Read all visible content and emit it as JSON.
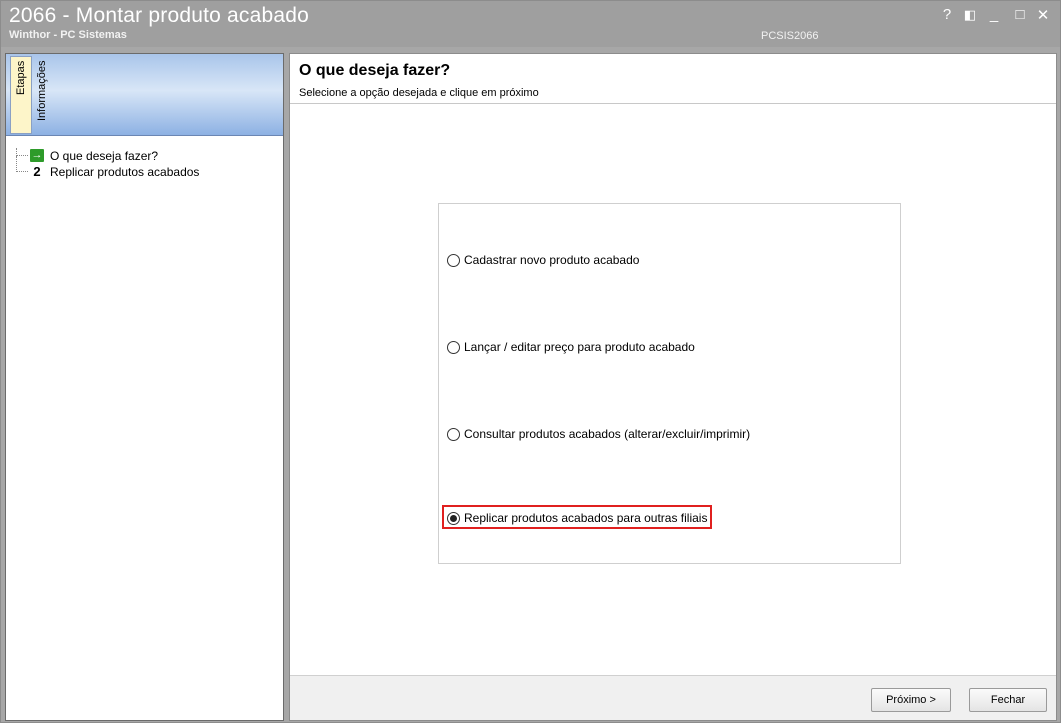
{
  "window": {
    "title": "2066 - Montar produto acabado",
    "subtitle": "Winthor - PC Sistemas",
    "app_code": "PCSIS2066",
    "controls": {
      "help": "?",
      "restore": "◧",
      "minimize": "_",
      "maximize": "□",
      "close": "✕"
    }
  },
  "sidebar": {
    "tabs": [
      "Etapas",
      "Informações"
    ],
    "steps": [
      {
        "icon": "→",
        "label": "O que deseja fazer?"
      },
      {
        "icon": "2",
        "label": "Replicar produtos acabados"
      }
    ]
  },
  "main": {
    "title": "O que deseja fazer?",
    "subtitle": "Selecione a opção desejada e clique em próximo",
    "options": [
      {
        "label": "Cadastrar novo produto acabado",
        "checked": false
      },
      {
        "label": "Lançar / editar preço para produto acabado",
        "checked": false
      },
      {
        "label": "Consultar produtos acabados (alterar/excluir/imprimir)",
        "checked": false
      },
      {
        "label": "Replicar produtos acabados para outras filiais",
        "checked": true
      }
    ]
  },
  "footer": {
    "next_label": "Próximo >",
    "close_label": "Fechar"
  },
  "colors": {
    "highlight": "#e0201f",
    "step_arrow": "#2e9b2a",
    "tab_active": "#fdf5c9"
  }
}
